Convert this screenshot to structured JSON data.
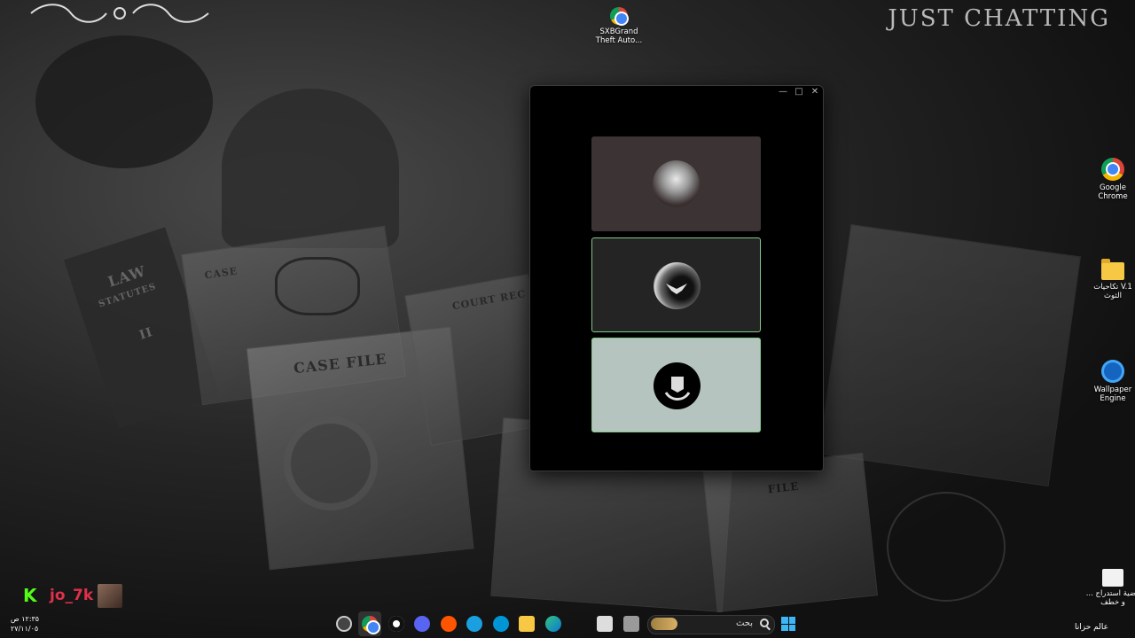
{
  "wallpaper": {
    "book_title_1": "LAW",
    "book_subtitle_1": "STATUTES",
    "book_volume": "II",
    "paper_case": "CASE",
    "paper_case_file": "CASE FILE",
    "paper_court": "COURT REC",
    "paper_file": "FILE"
  },
  "brand_text": "JUST CHATTING",
  "desktop_icons": [
    {
      "label": "SXBGrand Theft Auto...",
      "icon": "chrome-shortcut-icon"
    },
    {
      "label": "Google Chrome",
      "icon": "chrome-icon"
    },
    {
      "label": "تكاحيات V.1 الثوث",
      "icon": "folder-icon"
    },
    {
      "label": "Wallpaper Engine",
      "icon": "wallpaper-engine-icon"
    },
    {
      "label": "قضية استدراج ... و خطف",
      "icon": "document-icon"
    }
  ],
  "window": {
    "controls": {
      "minimize": "—",
      "maximize": "□",
      "close": "✕"
    },
    "cards": [
      {
        "name": "profile-card-1",
        "avatar": "man-in-ghutra-avatar",
        "selected": false
      },
      {
        "name": "profile-card-2",
        "avatar": "eagle-moon-avatar",
        "selected": true
      },
      {
        "name": "profile-card-3",
        "avatar": "hand-emblem-avatar",
        "selected": true
      }
    ]
  },
  "overlay": {
    "kick_logo": "K",
    "username": "jo_7k"
  },
  "taskbar": {
    "time": "١٢:٣٥ ص",
    "date": "٢٧/١١/٠٥",
    "search_placeholder": "بحث",
    "bottom_right_text": "عالم حزانا"
  }
}
